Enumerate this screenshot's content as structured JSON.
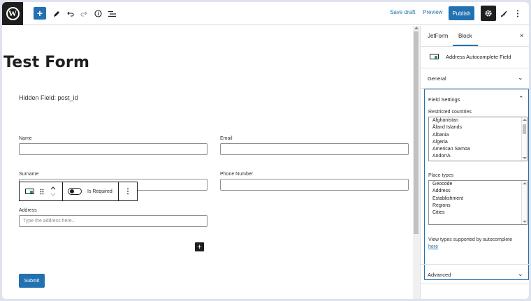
{
  "toolbar": {
    "save_draft": "Save draft",
    "preview": "Preview",
    "publish": "Publish",
    "icons": [
      "wordpress-logo",
      "add-block",
      "edit-pencil",
      "undo",
      "redo",
      "info",
      "list-view",
      "settings-gear",
      "brush",
      "more-vertical"
    ]
  },
  "canvas": {
    "form_title": "Test Form",
    "hidden_field": "Hidden Field: post_id",
    "fields": {
      "name_label": "Name",
      "email_label": "Email",
      "surname_label": "Surname",
      "phone_label": "Phone Number",
      "address_label": "Address",
      "address_placeholder": "Type the address here..."
    },
    "block_toolbar": {
      "is_required": "Is Required"
    },
    "submit": "Submit"
  },
  "sidebar": {
    "tabs": [
      "JetForm",
      "Block"
    ],
    "active_tab": "Block",
    "close": "×",
    "block_title": "Address Autocomplete Field",
    "panels": {
      "general": "General",
      "field_settings": "Field Settings",
      "advanced": "Advanced"
    },
    "restricted_countries_label": "Restricted countries",
    "countries": [
      "Afghanistan",
      "Åland Islands",
      "Albania",
      "Algeria",
      "American Samoa",
      "AndorrA"
    ],
    "place_types_label": "Place types",
    "place_types": [
      "Geocode",
      "Address",
      "Establishment",
      "Regions",
      "Cities"
    ],
    "note": "View types supported by autocomplete",
    "note_link": "here"
  },
  "colors": {
    "accent": "#2271b1",
    "dark": "#1e1e1e",
    "border": "#8c8f94"
  }
}
